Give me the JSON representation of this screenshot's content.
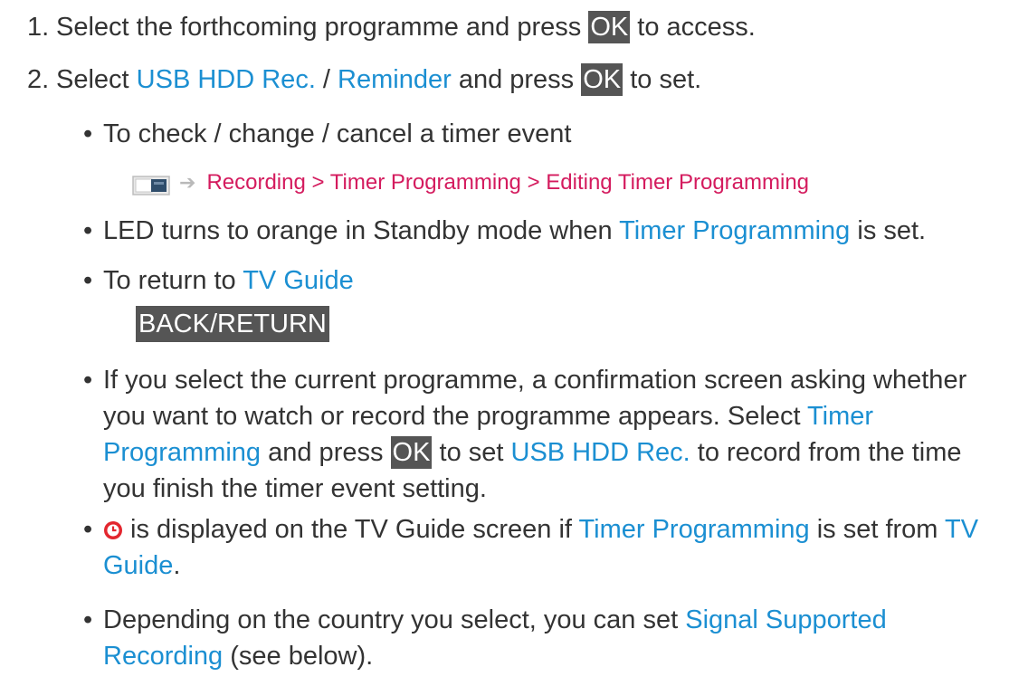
{
  "steps": [
    {
      "number": "1.",
      "pre": "Select the forthcoming programme and press ",
      "key": "OK",
      "post": " to access."
    },
    {
      "number": "2.",
      "pre": "Select ",
      "link1": "USB HDD Rec.",
      "sep": " / ",
      "link2": "Reminder",
      "mid": " and press ",
      "key": "OK",
      "post": " to set."
    }
  ],
  "bullets": {
    "check_change": {
      "text": "To check / change / cancel a timer event"
    },
    "menu_path": {
      "icon": "menu-screen-icon",
      "arrow": "➔",
      "text": "Recording > Timer Programming > Editing Timer Programming"
    },
    "led": {
      "pre": "LED turns to orange in Standby mode when ",
      "link": "Timer Programming",
      "post": " is set."
    },
    "return": {
      "pre": "To return to ",
      "link": "TV Guide"
    },
    "back_key": "BACK/RETURN",
    "current": {
      "pre": "If you select the current programme, a confirmation screen asking whether you want to watch or record the programme appears. Select ",
      "link1": "Timer Programming",
      "mid1": " and press ",
      "key": "OK",
      "mid2": " to set ",
      "link2": "USB HDD Rec.",
      "post": " to record from the time you finish the timer event setting."
    },
    "clock": {
      "icon": "clock-icon",
      "pre": " is displayed on the TV Guide screen if ",
      "link1": "Timer Programming",
      "mid": " is set from ",
      "link2": "TV Guide",
      "post": "."
    },
    "country": {
      "pre": "Depending on the country you select, you can set ",
      "link": "Signal Supported Recording",
      "post": " (see below)."
    }
  },
  "colors": {
    "link": "#1b8fd2",
    "menu_path": "#d41b5e",
    "key_bg": "#555555",
    "text": "#333333"
  }
}
